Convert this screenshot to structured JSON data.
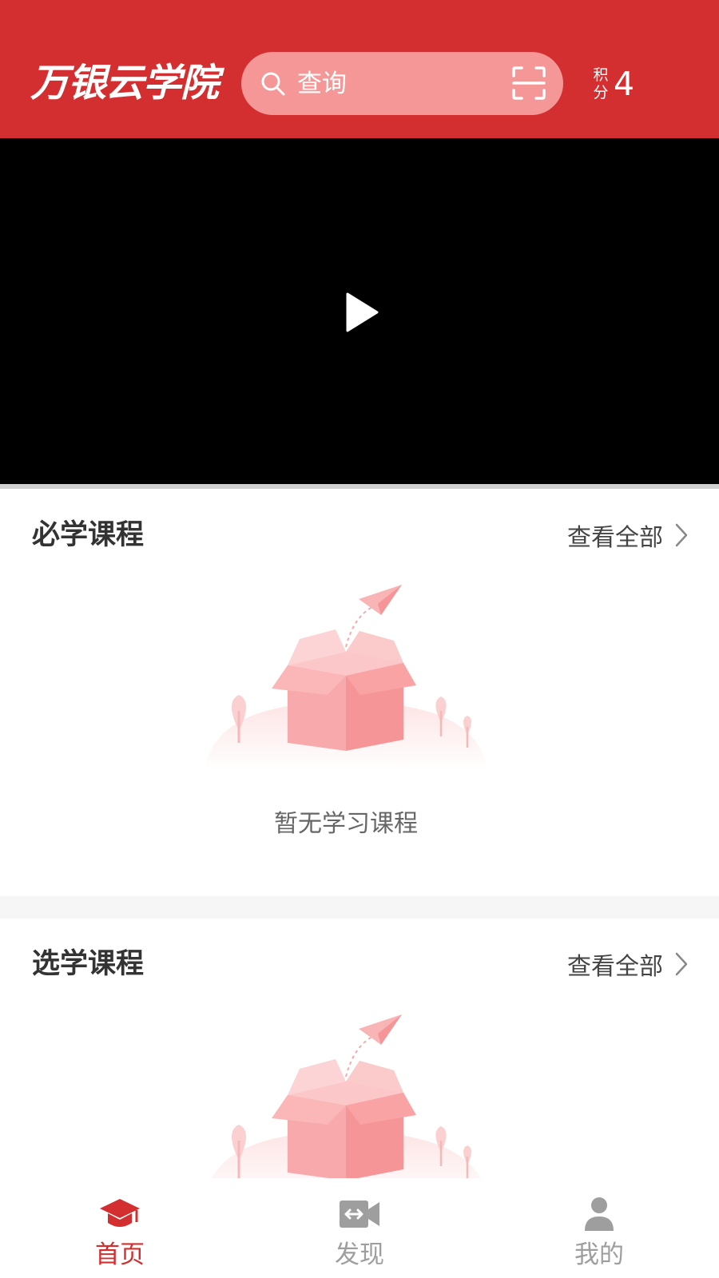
{
  "header": {
    "logo_text": "万银云学院",
    "search": {
      "placeholder": "查询",
      "icon": "search-icon",
      "scan_icon": "scan-icon"
    },
    "points": {
      "label": "积分",
      "value": "4"
    }
  },
  "video": {
    "play_icon": "play-icon"
  },
  "sections": {
    "required": {
      "title": "必学课程",
      "view_all": "查看全部",
      "empty_text": "暂无学习课程"
    },
    "elective": {
      "title": "选学课程",
      "view_all": "查看全部"
    }
  },
  "tabbar": {
    "items": [
      {
        "label": "首页",
        "icon": "graduation-cap-icon",
        "active": true
      },
      {
        "label": "发现",
        "icon": "video-camera-icon",
        "active": false
      },
      {
        "label": "我的",
        "icon": "user-icon",
        "active": false
      }
    ]
  },
  "colors": {
    "brand_red": "#d32f30",
    "search_bg": "#f69797",
    "tab_active": "#d32f30",
    "tab_inactive": "#9e9e9e"
  }
}
